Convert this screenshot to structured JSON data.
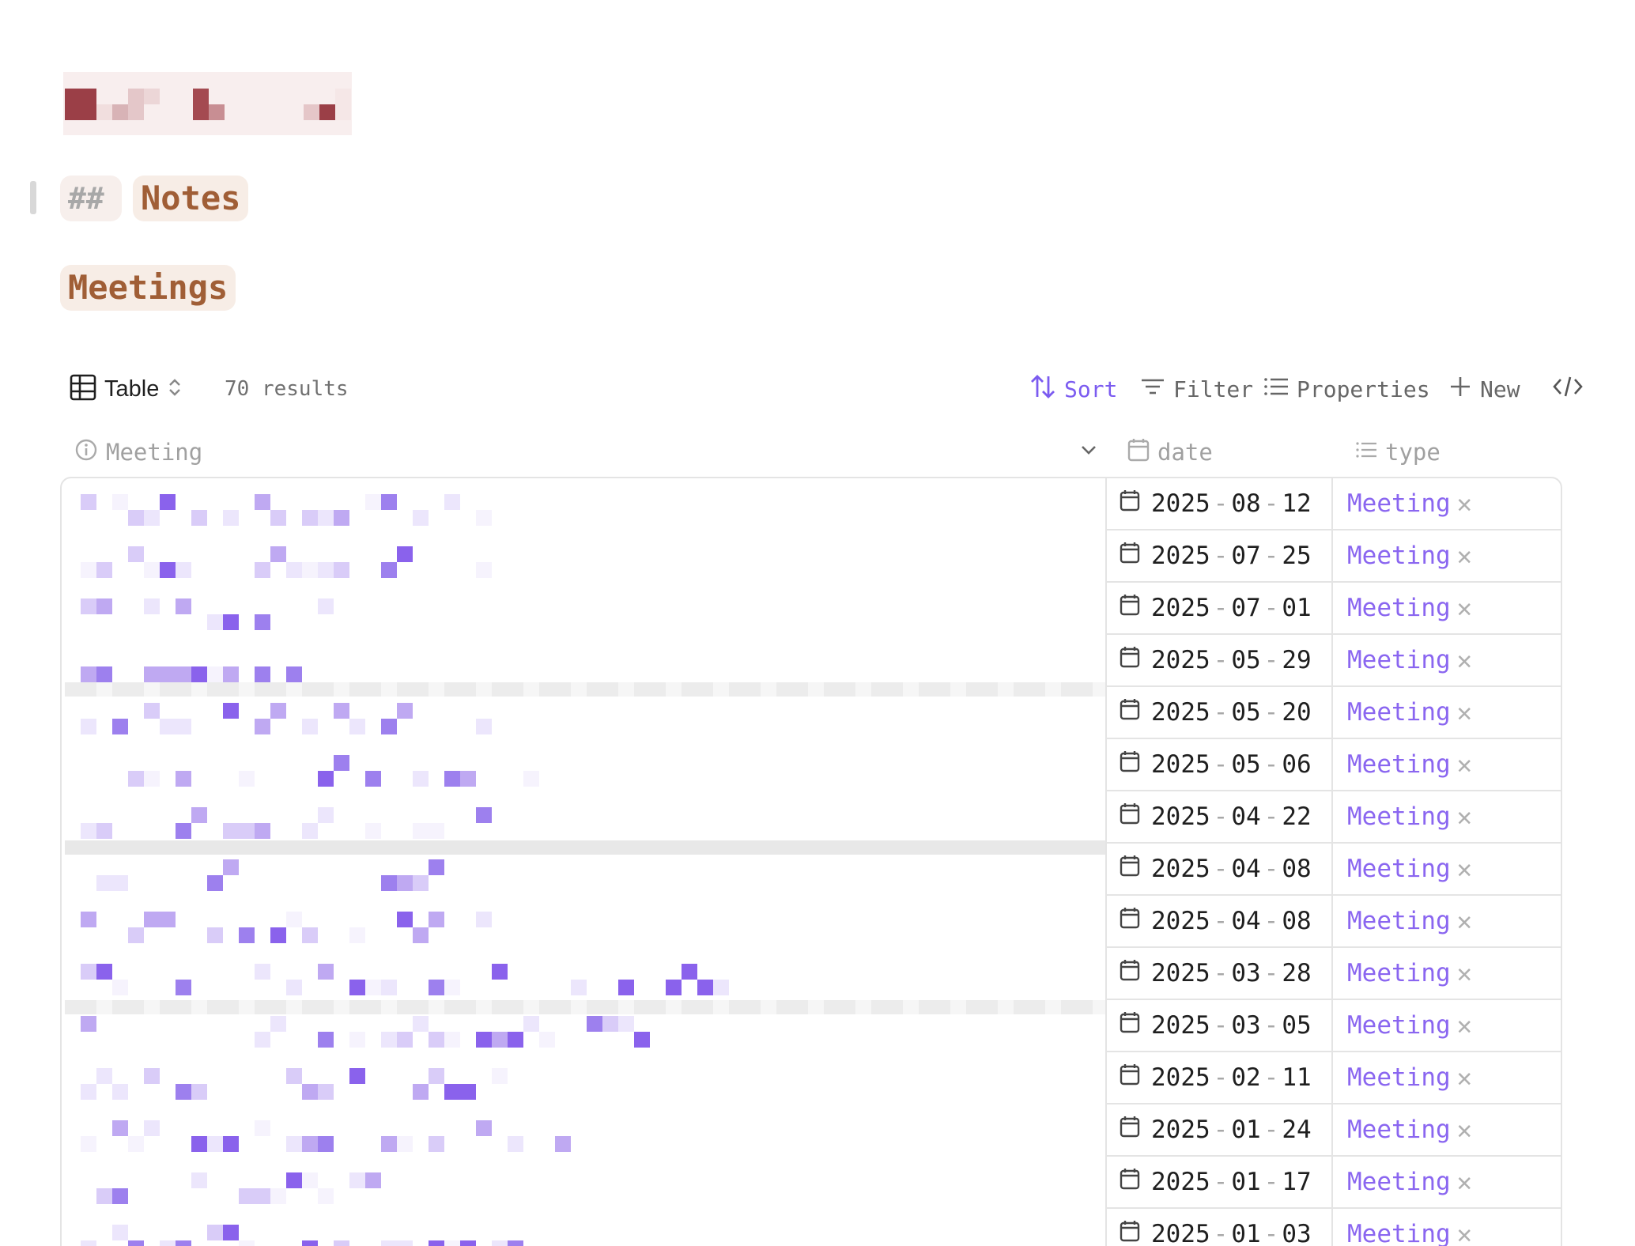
{
  "page": {
    "heading_prefix": "##",
    "heading": "Notes",
    "section_title": "Meetings"
  },
  "toolbar": {
    "view_label": "Table",
    "results": "70 results",
    "sort_label": "Sort",
    "filter_label": "Filter",
    "properties_label": "Properties",
    "new_label": "New"
  },
  "columns": {
    "meeting": "Meeting",
    "date": "date",
    "type": "type"
  },
  "rows": [
    {
      "y": "2025",
      "m": "08",
      "d": "12",
      "type": "Meeting"
    },
    {
      "y": "2025",
      "m": "07",
      "d": "25",
      "type": "Meeting"
    },
    {
      "y": "2025",
      "m": "07",
      "d": "01",
      "type": "Meeting"
    },
    {
      "y": "2025",
      "m": "05",
      "d": "29",
      "type": "Meeting"
    },
    {
      "y": "2025",
      "m": "05",
      "d": "20",
      "type": "Meeting"
    },
    {
      "y": "2025",
      "m": "05",
      "d": "06",
      "type": "Meeting"
    },
    {
      "y": "2025",
      "m": "04",
      "d": "22",
      "type": "Meeting"
    },
    {
      "y": "2025",
      "m": "04",
      "d": "08",
      "type": "Meeting"
    },
    {
      "y": "2025",
      "m": "04",
      "d": "08",
      "type": "Meeting"
    },
    {
      "y": "2025",
      "m": "03",
      "d": "28",
      "type": "Meeting"
    },
    {
      "y": "2025",
      "m": "03",
      "d": "05",
      "type": "Meeting"
    },
    {
      "y": "2025",
      "m": "02",
      "d": "11",
      "type": "Meeting"
    },
    {
      "y": "2025",
      "m": "01",
      "d": "24",
      "type": "Meeting"
    },
    {
      "y": "2025",
      "m": "01",
      "d": "17",
      "type": "Meeting"
    },
    {
      "y": "2025",
      "m": "01",
      "d": "03",
      "type": "Meeting"
    }
  ],
  "colors": {
    "accent": "#7b5bf0",
    "heading": "#a05e36",
    "tag": "#8a66f0"
  }
}
